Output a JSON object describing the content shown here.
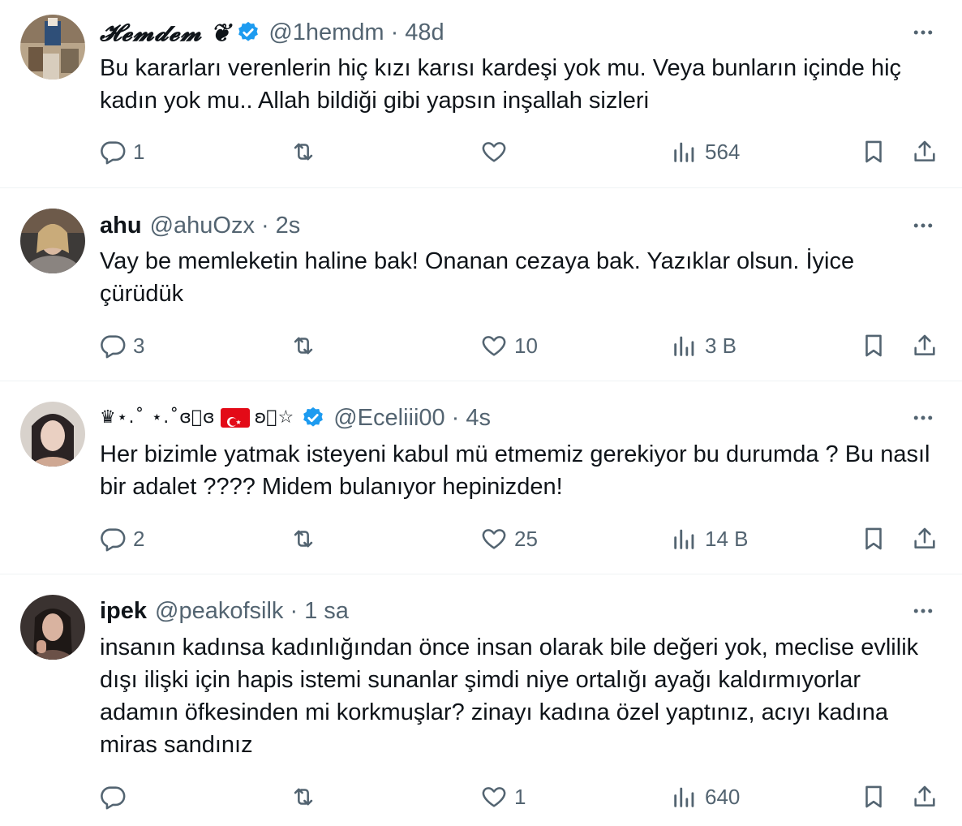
{
  "tweets": [
    {
      "name": "𝓗𝓮𝓶𝓭𝓮𝓶 ❦",
      "handle": "@1hemdm",
      "sep": "·",
      "time": "48d",
      "text": "Bu kararları verenlerin hiç kızı karısı kardeşi yok mu. Veya bunların içinde hiç kadın yok mu.. Allah bildiği gibi yapsın inşallah sizleri",
      "replies": "1",
      "reposts": "",
      "likes": "",
      "views": "564"
    },
    {
      "name": "ahu",
      "handle": "@ahuOzx",
      "sep": "·",
      "time": "2s",
      "text": "Vay be memleketin haline bak! Onanan cezaya bak. Yazıklar olsun. İyice çürüdük",
      "replies": "3",
      "reposts": "",
      "likes": "10",
      "views": "3 B"
    },
    {
      "name_prefix": "♛⋆.˚ ⋆.˚ɞ⃝ɞ",
      "name_suffix": "ʚ⃝☆",
      "handle": "@Eceliii00",
      "sep": "·",
      "time": "4s",
      "text": "Her bizimle yatmak isteyeni kabul mü etmemiz gerekiyor bu durumda ? Bu nasıl bir adalet ????  Midem bulanıyor hepinizden!",
      "replies": "2",
      "reposts": "",
      "likes": "25",
      "views": "14 B"
    },
    {
      "name": "ipek",
      "handle": "@peakofsilk",
      "sep": "·",
      "time": "1 sa",
      "text": "insanın kadınsa kadınlığından önce insan olarak bile değeri yok, meclise evlilik dışı ilişki için hapis istemi sunanlar şimdi niye ortalığı ayağı kaldırmıyorlar adamın öfkesinden mi korkmuşlar? zinayı kadına özel yaptınız, acıyı kadına miras sandınız",
      "replies": "",
      "reposts": "",
      "likes": "1",
      "views": "640"
    }
  ],
  "colors": {
    "text": "#0f1419",
    "secondary": "#536471",
    "verified": "#1d9bf0",
    "divider": "#eff3f4",
    "flag": "#e30a17"
  },
  "icons": [
    "reply-icon",
    "repost-icon",
    "like-icon",
    "views-icon",
    "bookmark-icon",
    "share-icon",
    "more-icon",
    "verified-badge-icon"
  ]
}
